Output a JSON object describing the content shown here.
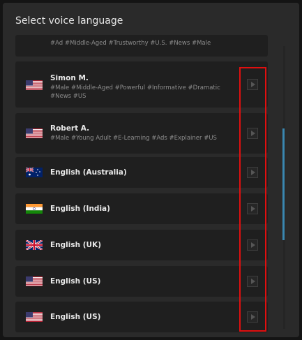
{
  "modal": {
    "title": "Select voice language"
  },
  "voices": [
    {
      "flag": "us",
      "name": "",
      "tags": "#Ad #Middle-Aged #Trustworthy #U.S. #News #Male"
    },
    {
      "flag": "us",
      "name": "Simon M.",
      "tags": "#Male #Middle-Aged #Powerful #Informative #Dramatic #News #US"
    },
    {
      "flag": "us",
      "name": "Robert A.",
      "tags": "#Male #Young Adult #E-Learning #Ads #Explainer #US"
    },
    {
      "flag": "au",
      "name": "English (Australia)",
      "tags": ""
    },
    {
      "flag": "in",
      "name": "English (India)",
      "tags": ""
    },
    {
      "flag": "uk",
      "name": "English (UK)",
      "tags": ""
    },
    {
      "flag": "us",
      "name": "English (US)",
      "tags": ""
    },
    {
      "flag": "us",
      "name": "English (US)",
      "tags": ""
    }
  ],
  "icons": {
    "play": "play-icon",
    "flags": [
      "us-flag-icon",
      "australia-flag-icon",
      "india-flag-icon",
      "uk-flag-icon"
    ]
  },
  "colors": {
    "accent_scroll": "#3a87b0",
    "highlight_box": "#e10f0f",
    "modal_bg": "#2a2a2a",
    "row_bg": "#1f1f1f"
  }
}
